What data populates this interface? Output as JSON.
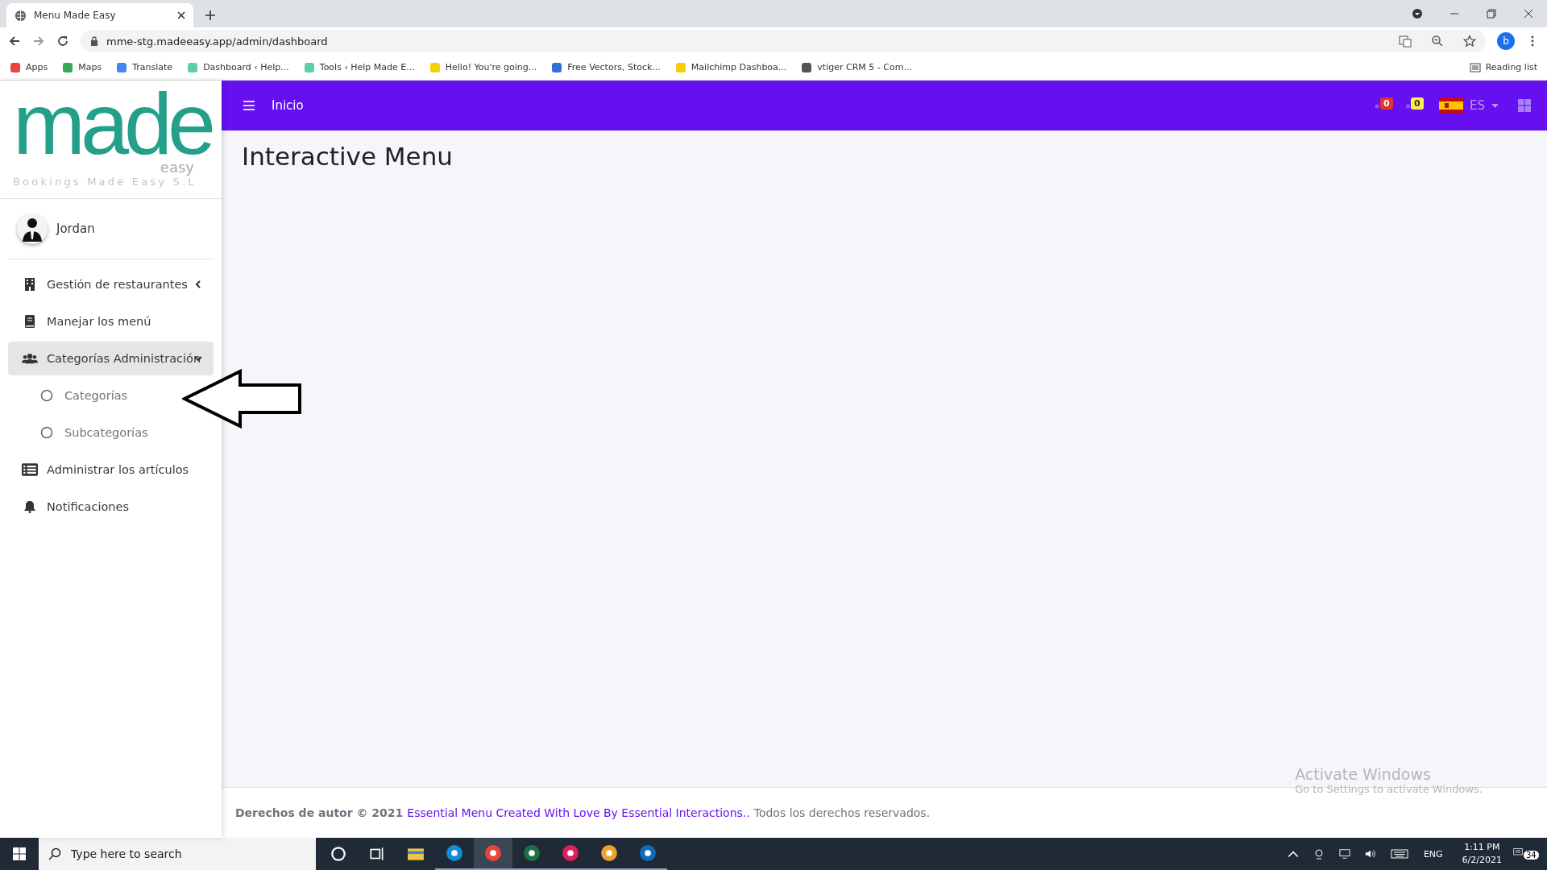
{
  "browser": {
    "tab_title": "Menu Made Easy",
    "url": "mme-stg.madeeasy.app/admin/dashboard",
    "profile": "b",
    "bookmarks": [
      "Apps",
      "Maps",
      "Translate",
      "Dashboard ‹ Help...",
      "Tools ‹ Help Made E...",
      "Hello! You're going...",
      "Free Vectors, Stock...",
      "Mailchimp Dashboa...",
      "vtiger CRM 5 - Com..."
    ],
    "reading_list": "Reading list"
  },
  "sidebar": {
    "logo": {
      "word": "made",
      "sub": "easy",
      "tagline": "Bookings Made Easy S.L"
    },
    "user": "Jordan",
    "items": [
      {
        "label": "Gestión de restaurantes",
        "kind": "group",
        "expanded": false,
        "selected": false
      },
      {
        "label": "Manejar los menú",
        "kind": "link",
        "selected": false
      },
      {
        "label": "Categorías Administración",
        "kind": "group",
        "expanded": true,
        "selected": true,
        "children": [
          {
            "label": "Categorías",
            "selected": false
          },
          {
            "label": "Subcategorías",
            "selected": false
          }
        ]
      },
      {
        "label": "Administrar los artículos",
        "kind": "link",
        "selected": false
      },
      {
        "label": "Notificaciones",
        "kind": "link",
        "selected": false
      }
    ]
  },
  "topbar": {
    "title": "Inicio",
    "messages_count": "0",
    "notifications_count": "0",
    "language": "ES"
  },
  "page_title": "Interactive Menu",
  "footer": {
    "prefix": "Derechos de autor © 2021",
    "link": "Essential Menu Created With Love By Essential Interactions..",
    "suffix": "Todos los derechos reservados."
  },
  "activation_notice": {
    "title": "Activate Windows",
    "text": "Go to Settings to activate Windows."
  },
  "taskbar": {
    "search_placeholder": "Type here to search",
    "apps": [
      {
        "running": false,
        "selected": false
      },
      {
        "running": false,
        "selected": false
      },
      {
        "running": false,
        "selected": false
      },
      {
        "running": true,
        "selected": false
      },
      {
        "running": true,
        "selected": true
      },
      {
        "running": true,
        "selected": false
      },
      {
        "running": true,
        "selected": false
      },
      {
        "running": true,
        "selected": false
      },
      {
        "running": true,
        "selected": false
      }
    ],
    "language": "ENG",
    "time": "1:11 PM",
    "date": "6/2/2021",
    "notification_count": "34"
  }
}
